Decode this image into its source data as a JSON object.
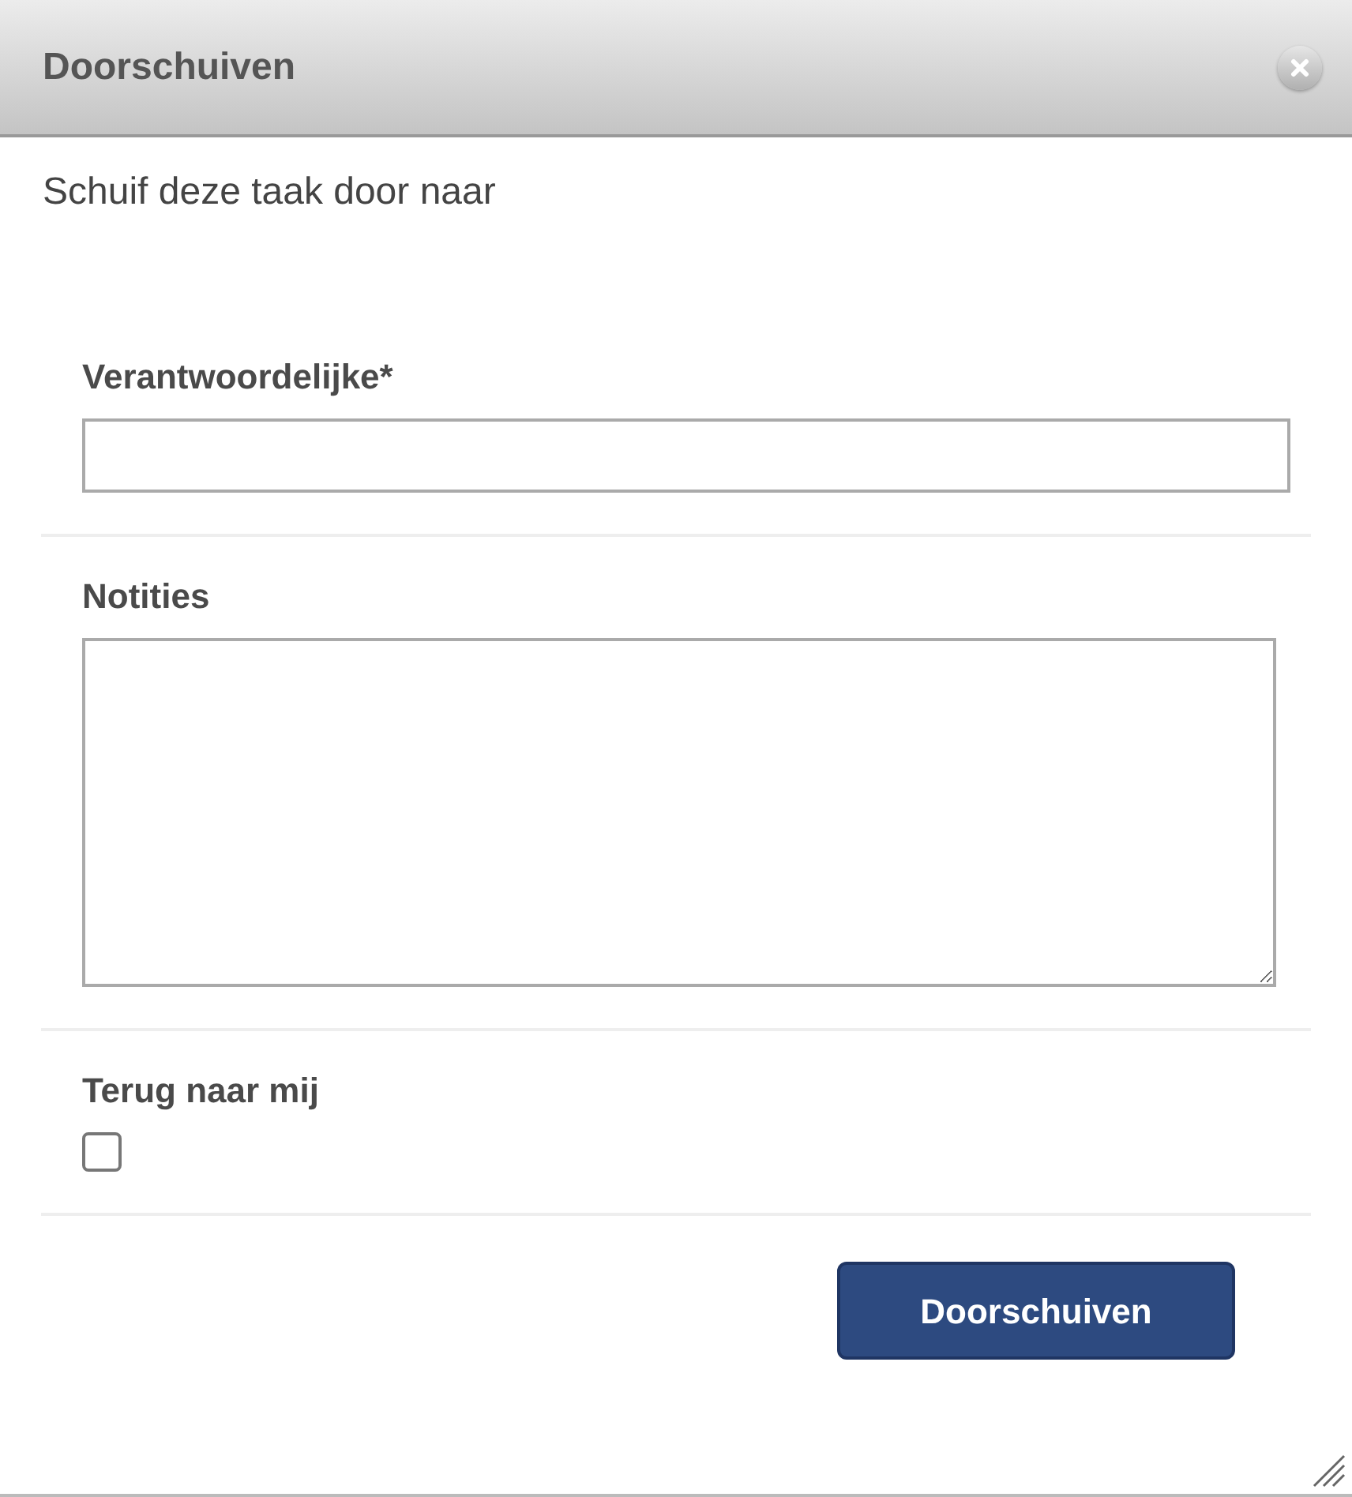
{
  "dialog": {
    "title": "Doorschuiven",
    "subtitle": "Schuif deze taak door naar"
  },
  "fields": [
    {
      "kind": "text",
      "label": "Verantwoordelijke*"
    },
    {
      "kind": "textarea",
      "label": "Notities"
    },
    {
      "kind": "checkbox",
      "label": "Terug naar mij",
      "checked": false
    }
  ],
  "submit_button": "Doorschuiven"
}
